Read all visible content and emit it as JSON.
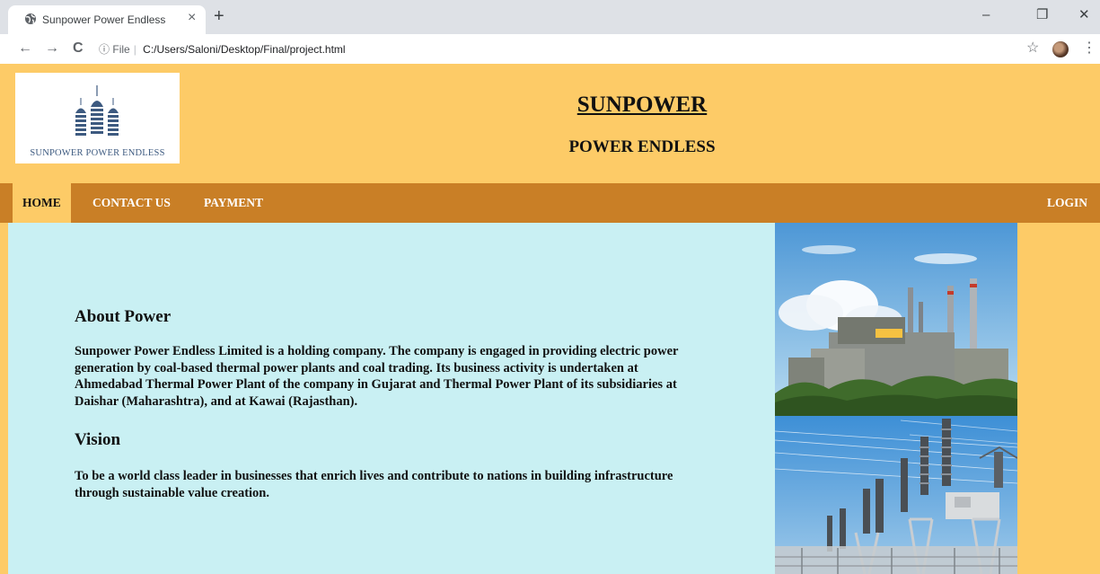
{
  "browser": {
    "tab_title": "Sunpower Power Endless",
    "tab_close": "×",
    "new_tab": "+",
    "window_minimize": "–",
    "window_restore": "❐",
    "window_close": "✕",
    "back": "←",
    "forward": "→",
    "reload": "C",
    "info_icon": "ⓘ",
    "scheme_label": "File",
    "url": "C:/Users/Saloni/Desktop/Final/project.html",
    "bookmark_star": "☆",
    "menu": "⋮"
  },
  "header": {
    "logo_text": "SUNPOWER POWER ENDLESS",
    "title": "SUNPOWER",
    "subtitle": "POWER ENDLESS"
  },
  "nav": {
    "home": "HOME",
    "contact": "CONTACT US",
    "payment": "PAYMENT",
    "login": "LOGIN"
  },
  "content": {
    "about_heading": "About Power",
    "about_text": "Sunpower Power Endless Limited is a holding company. The company is engaged in providing electric power generation by coal-based thermal power plants and coal trading. Its business activity is undertaken at Ahmedabad Thermal Power Plant of the company in Gujarat and Thermal Power Plant of its subsidiaries at Daishar (Maharashtra), and at Kawai (Rajasthan).",
    "vision_heading": "Vision",
    "vision_text": "To be a world class leader in businesses that enrich lives and contribute to nations in building infrastructure through sustainable value creation."
  },
  "colors": {
    "header_bg": "#fdcb67",
    "nav_bg": "#c97f26",
    "content_bg": "#c9f0f3"
  }
}
